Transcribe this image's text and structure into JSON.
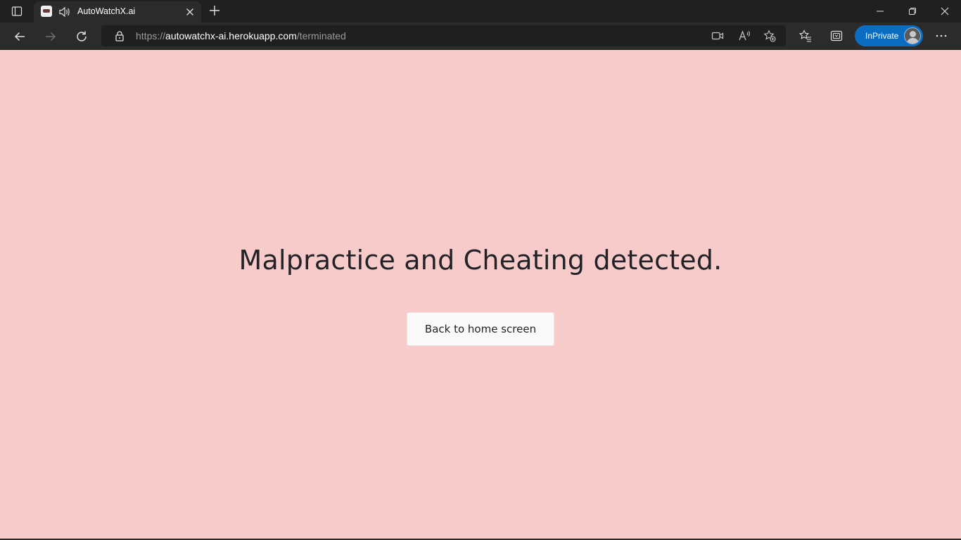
{
  "tab": {
    "title": "AutoWatchX.ai"
  },
  "address_bar": {
    "scheme": "https://",
    "host": "autowatchx-ai.herokuapp.com",
    "path": "/terminated"
  },
  "profile": {
    "label": "InPrivate"
  },
  "page": {
    "background": "#f8cbcb",
    "headline": "Malpractice and Cheating detected.",
    "button_label": "Back to home screen"
  },
  "icons": {
    "tab_actions": "tab-actions-icon",
    "audio": "speaker-icon",
    "tab_close": "close-icon",
    "new_tab": "plus-icon",
    "minimize": "minimize-icon",
    "restore": "restore-icon",
    "close_window": "close-icon",
    "back": "arrow-left-icon",
    "forward": "arrow-right-icon",
    "reload": "reload-icon",
    "lock": "lock-icon",
    "camera": "video-camera-icon",
    "read_aloud": "read-aloud-icon",
    "add_favorite": "star-add-icon",
    "favorites": "favorites-list-icon",
    "collections": "collections-icon",
    "more": "more-icon"
  }
}
